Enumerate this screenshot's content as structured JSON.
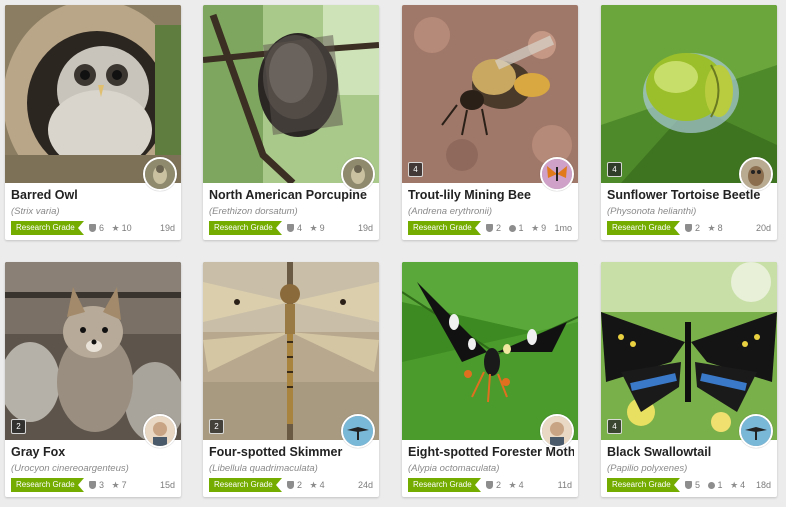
{
  "colors": {
    "badge": "#74ac00",
    "page_bg": "#ececec"
  },
  "cards": [
    {
      "common_name": "Barred Owl",
      "scientific_name": "Strix varia",
      "grade": "Research Grade",
      "identifications": "6",
      "comments": null,
      "faves": "10",
      "time": "19d",
      "photo_count": null,
      "photo_icon": "owl-photo",
      "avatar_icon": "bird-avatar"
    },
    {
      "common_name": "North American Porcupine",
      "scientific_name": "Erethizon dorsatum",
      "grade": "Research Grade",
      "identifications": "4",
      "comments": null,
      "faves": "9",
      "time": "19d",
      "photo_count": null,
      "photo_icon": "porcupine-photo",
      "avatar_icon": "bird-avatar"
    },
    {
      "common_name": "Trout-lily Mining Bee",
      "scientific_name": "Andrena erythronii",
      "grade": "Research Grade",
      "identifications": "2",
      "comments": "1",
      "faves": "9",
      "time": "1mo",
      "photo_count": "4",
      "photo_icon": "bee-photo",
      "avatar_icon": "butterfly-avatar"
    },
    {
      "common_name": "Sunflower Tortoise Beetle",
      "scientific_name": "Physonota helianthi",
      "grade": "Research Grade",
      "identifications": "2",
      "comments": null,
      "faves": "8",
      "time": "20d",
      "photo_count": "4",
      "photo_icon": "beetle-photo",
      "avatar_icon": "owl-avatar"
    },
    {
      "common_name": "Gray Fox",
      "scientific_name": "Urocyon cinereoargenteus",
      "grade": "Research Grade",
      "identifications": "3",
      "comments": null,
      "faves": "7",
      "time": "15d",
      "photo_count": "2",
      "photo_icon": "fox-photo",
      "avatar_icon": "person-avatar"
    },
    {
      "common_name": "Four-spotted Skimmer",
      "scientific_name": "Libellula quadrimaculata",
      "grade": "Research Grade",
      "identifications": "2",
      "comments": null,
      "faves": "4",
      "time": "24d",
      "photo_count": "2",
      "photo_icon": "dragonfly-photo",
      "avatar_icon": "bird-flight-avatar"
    },
    {
      "common_name": "Eight-spotted Forester Moth",
      "scientific_name": "Alypia octomaculata",
      "grade": "Research Grade",
      "identifications": "2",
      "comments": null,
      "faves": "4",
      "time": "11d",
      "photo_count": null,
      "photo_icon": "moth-photo",
      "avatar_icon": "person-avatar"
    },
    {
      "common_name": "Black Swallowtail",
      "scientific_name": "Papilio polyxenes",
      "grade": "Research Grade",
      "identifications": "5",
      "comments": "1",
      "faves": "4",
      "time": "18d",
      "photo_count": "4",
      "photo_icon": "swallowtail-photo",
      "avatar_icon": "bird-flight-avatar"
    }
  ]
}
